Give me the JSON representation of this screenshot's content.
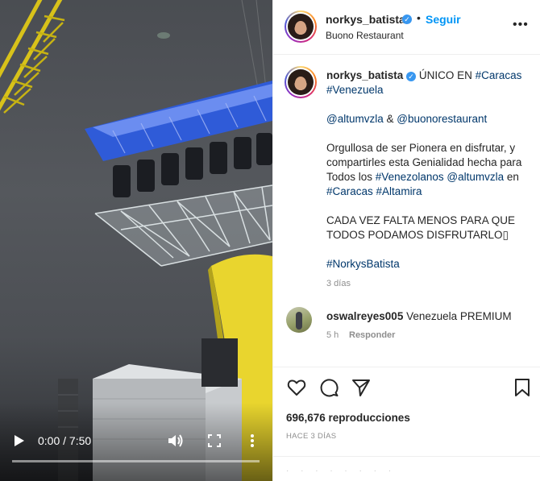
{
  "video": {
    "time_display": "0:00 / 7:50",
    "progress_fraction": 0.0
  },
  "post": {
    "author": {
      "username": "norkys_batista",
      "verified": true,
      "location": "Buono Restaurant"
    },
    "follow_label": "Seguir",
    "separator": "•",
    "more_label": "•••",
    "caption": {
      "username": "norkys_batista",
      "lines": {
        "l1_text": "ÚNICO EN ",
        "l1_tag1": "#Caracas",
        "l1_tag2": "#Venezuela",
        "l2_mention1": "@altumvzla",
        "l2_amp": " & ",
        "l2_mention2": "@buonorestaurant",
        "l3_text": "Orgullosa de ser Pionera en disfrutar, y compartirles esta Genialidad hecha para Todos los ",
        "l3_tag1": "#Venezolanos",
        "l3_mention": "@altumvzla",
        "l3_en": " en ",
        "l3_tag2": "#Caracas",
        "l3_tag3": "#Altamira",
        "l4_text": "CADA VEZ FALTA MENOS PARA QUE TODOS PODAMOS DISFRUTARLO▯",
        "l5_tag": "#NorkysBatista"
      },
      "age": "3 días"
    },
    "comments": [
      {
        "username": "oswalreyes005",
        "text": "Venezuela PREMIUM",
        "age": "5 h",
        "reply_label": "Responder"
      }
    ],
    "views": "696,676 reproducciones",
    "date": "HACE 3 DÍAS"
  },
  "icons": {
    "like": "heart-outline-icon",
    "comment": "speech-bubble-icon",
    "share": "paper-plane-icon",
    "save": "bookmark-icon"
  },
  "colors": {
    "link": "#00376b",
    "follow": "#0095f6",
    "secondary_text": "#8e8e8e",
    "verified": "#3897f0"
  }
}
